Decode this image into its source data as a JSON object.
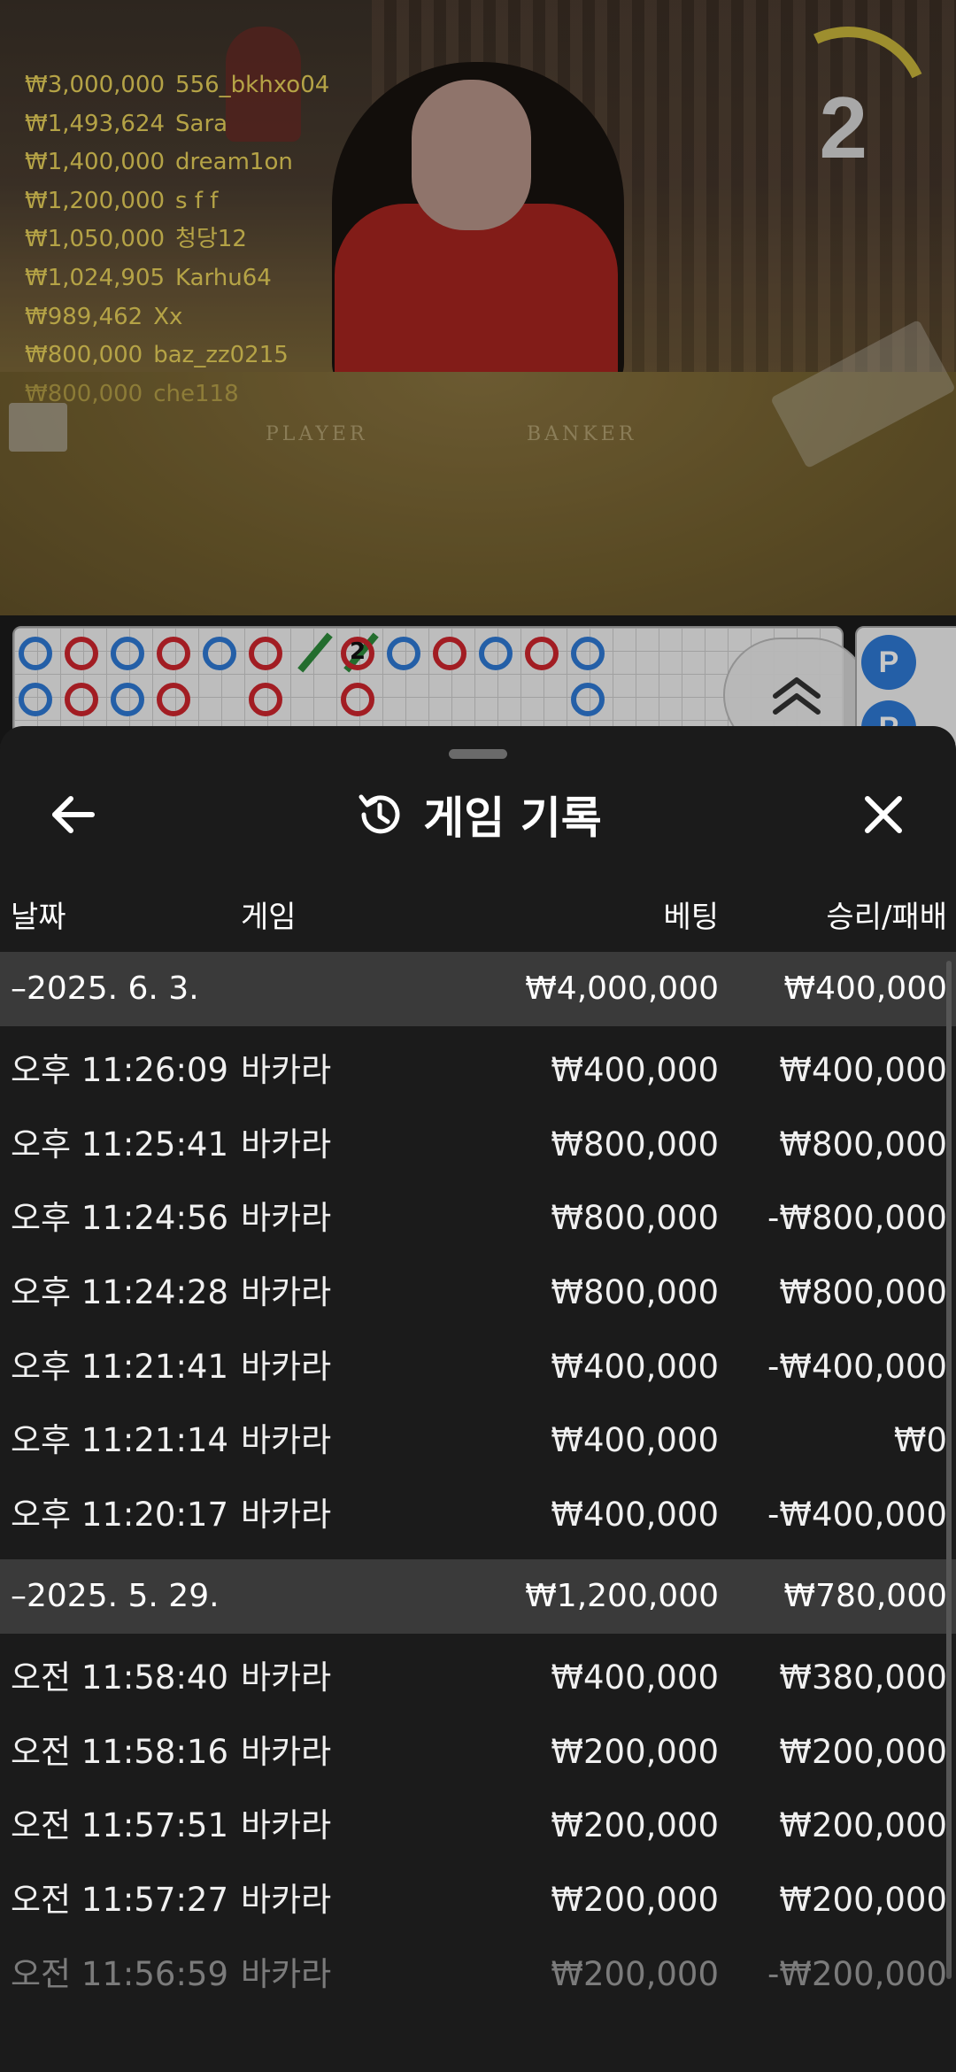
{
  "video": {
    "countdown": "2",
    "table_labels": {
      "player": "PLAYER",
      "banker": "BANKER"
    },
    "winners": [
      {
        "amount": "₩3,000,000",
        "name": "556_bkhxo04"
      },
      {
        "amount": "₩1,493,624",
        "name": "Sara"
      },
      {
        "amount": "₩1,400,000",
        "name": "dream1on"
      },
      {
        "amount": "₩1,200,000",
        "name": "s f f"
      },
      {
        "amount": "₩1,050,000",
        "name": "청당12"
      },
      {
        "amount": "₩1,024,905",
        "name": "Karhu64"
      },
      {
        "amount": "₩989,462",
        "name": "Xx"
      },
      {
        "amount": "₩800,000",
        "name": "baz_zz0215"
      },
      {
        "amount": "₩800,000",
        "name": "che118"
      }
    ]
  },
  "roadmap": {
    "tie_count": "2",
    "side_badge": "P",
    "colors": {
      "banker": "#d0262e",
      "player": "#2f7ad6",
      "tie": "#2e8c3c"
    }
  },
  "sheet": {
    "title": "게임 기록",
    "columns": {
      "date": "날짜",
      "game": "게임",
      "bet": "베팅",
      "result": "승리/패배"
    },
    "days": [
      {
        "date": "–2025. 6. 3.",
        "bet_total": "₩4,000,000",
        "result_total": "₩400,000",
        "rows": [
          {
            "time": "오후 11:26:09",
            "game": "바카라",
            "bet": "₩400,000",
            "result": "₩400,000"
          },
          {
            "time": "오후 11:25:41",
            "game": "바카라",
            "bet": "₩800,000",
            "result": "₩800,000"
          },
          {
            "time": "오후 11:24:56",
            "game": "바카라",
            "bet": "₩800,000",
            "result": "-₩800,000"
          },
          {
            "time": "오후 11:24:28",
            "game": "바카라",
            "bet": "₩800,000",
            "result": "₩800,000"
          },
          {
            "time": "오후 11:21:41",
            "game": "바카라",
            "bet": "₩400,000",
            "result": "-₩400,000"
          },
          {
            "time": "오후 11:21:14",
            "game": "바카라",
            "bet": "₩400,000",
            "result": "₩0"
          },
          {
            "time": "오후 11:20:17",
            "game": "바카라",
            "bet": "₩400,000",
            "result": "-₩400,000"
          }
        ]
      },
      {
        "date": "–2025. 5. 29.",
        "bet_total": "₩1,200,000",
        "result_total": "₩780,000",
        "rows": [
          {
            "time": "오전 11:58:40",
            "game": "바카라",
            "bet": "₩400,000",
            "result": "₩380,000"
          },
          {
            "time": "오전 11:58:16",
            "game": "바카라",
            "bet": "₩200,000",
            "result": "₩200,000"
          },
          {
            "time": "오전 11:57:51",
            "game": "바카라",
            "bet": "₩200,000",
            "result": "₩200,000"
          },
          {
            "time": "오전 11:57:27",
            "game": "바카라",
            "bet": "₩200,000",
            "result": "₩200,000"
          },
          {
            "time": "오전 11:56:59",
            "game": "바카라",
            "bet": "₩200,000",
            "result": "-₩200,000"
          }
        ]
      }
    ]
  }
}
